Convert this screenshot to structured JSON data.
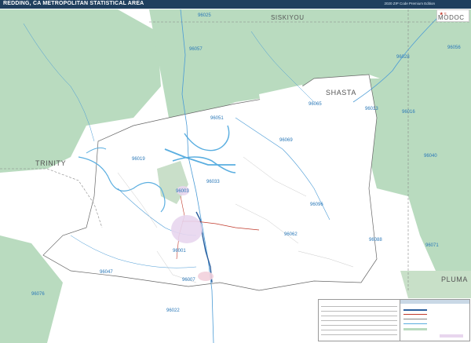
{
  "title": "REDDING, CA METROPOLITAN STATISTICAL AREA",
  "edition": "2020 ZIP Code Premium Edition",
  "counties": [
    {
      "name": "SISKIYOU"
    },
    {
      "name": "MODOC"
    },
    {
      "name": "SHASTA"
    },
    {
      "name": "TRINITY"
    },
    {
      "name": "PLUMA"
    }
  ],
  "zips": [
    "96025",
    "96057",
    "96028",
    "96056",
    "96051",
    "96065",
    "96013",
    "96016",
    "96003",
    "96019",
    "96033",
    "96069",
    "96096",
    "96040",
    "96088",
    "96062",
    "96071",
    "96001",
    "96047",
    "96007",
    "96076",
    "96022"
  ],
  "colors": {
    "forest": "#b9dbbf",
    "water": "#5aaee0",
    "background": "#dfe9df",
    "metro": "#ffffff",
    "title_bar": "#1f3f5e",
    "interstate": "#2c5f9e"
  }
}
